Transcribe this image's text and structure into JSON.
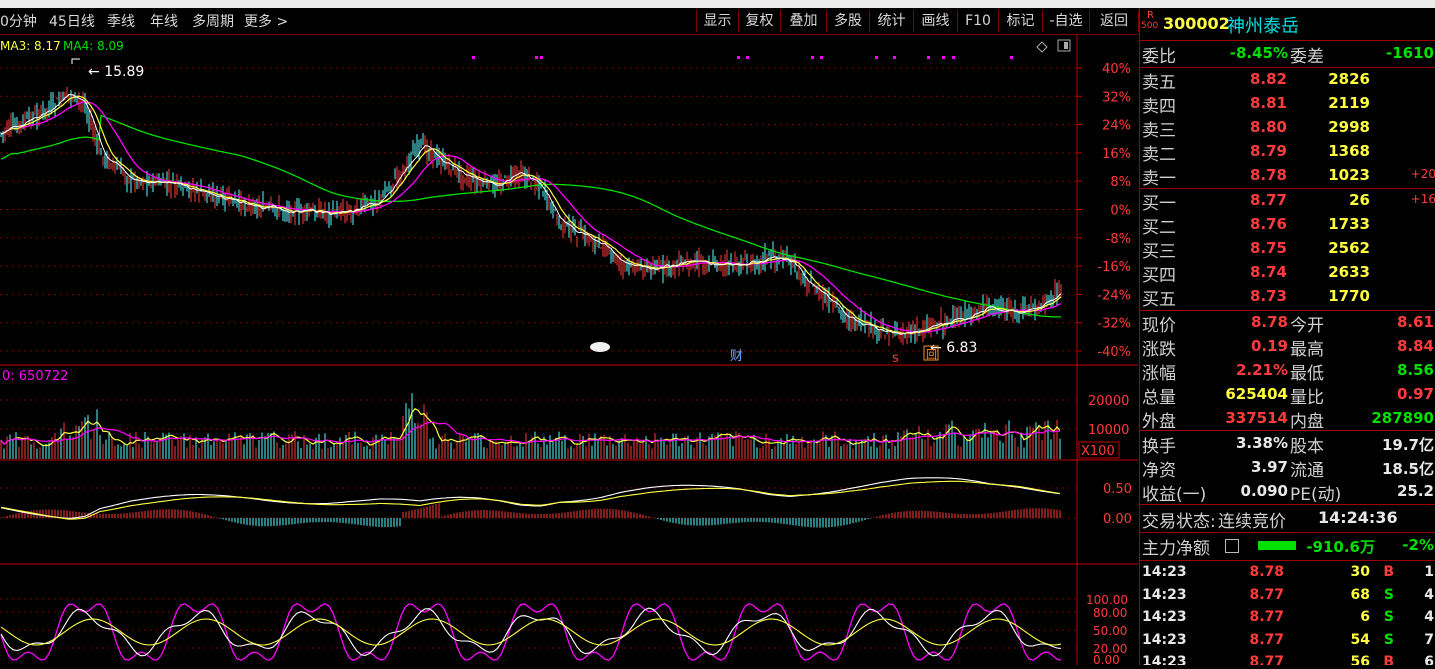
{
  "colors": {
    "up": "#ff3b3b",
    "down": "#54ffff",
    "ma_yellow": "#ffff40",
    "ma_magenta": "#ff00ff",
    "ma_green": "#00e000",
    "axis_red": "#c00000"
  },
  "period_buttons": [
    "0分钟",
    "45日线",
    "季线",
    "年线",
    "多周期",
    "更多 >"
  ],
  "tool_buttons": [
    "显示",
    "复权",
    "叠加",
    "多股",
    "统计",
    "画线",
    "F10",
    "标记",
    "-自选",
    "返回"
  ],
  "main_chart": {
    "ma_labels": [
      {
        "text": "MA3: 8.17",
        "color": "#ffff40"
      },
      {
        "text": "MA4: 8.09",
        "color": "#00e000"
      }
    ],
    "high_label": "15.89",
    "low_label": "6.83",
    "y_ticks": [
      "40%",
      "32%",
      "24%",
      "16%",
      "8%",
      "0%",
      "-8%",
      "-16%",
      "-24%",
      "-32%",
      "-40%"
    ],
    "fin_marker": "财",
    "event_markers": [
      "s",
      "回"
    ]
  },
  "volume_chart": {
    "label": "0: 650722",
    "y_ticks": [
      "20000",
      "10000"
    ],
    "unit": "X100"
  },
  "macd_chart": {
    "y_ticks": [
      "0.50",
      "0.00"
    ]
  },
  "kdj_chart": {
    "y_ticks": [
      "100.00",
      "80.00",
      "50.00",
      "20.00",
      "0.00"
    ]
  },
  "quote": {
    "badge_top": "R",
    "badge_bottom": "500",
    "code": "300002",
    "name": "神州泰岳",
    "weibi_label": "委比",
    "weibi_value": "-8.45%",
    "weicha_label": "委差",
    "weicha_value": "-1610",
    "asks": [
      {
        "label": "卖五",
        "price": "8.82",
        "vol": "2826",
        "chg": ""
      },
      {
        "label": "卖四",
        "price": "8.81",
        "vol": "2119",
        "chg": ""
      },
      {
        "label": "卖三",
        "price": "8.80",
        "vol": "2998",
        "chg": ""
      },
      {
        "label": "卖二",
        "price": "8.79",
        "vol": "1368",
        "chg": ""
      },
      {
        "label": "卖一",
        "price": "8.78",
        "vol": "1023",
        "chg": "+20"
      }
    ],
    "bids": [
      {
        "label": "买一",
        "price": "8.77",
        "vol": "26",
        "chg": "+16"
      },
      {
        "label": "买二",
        "price": "8.76",
        "vol": "1733",
        "chg": ""
      },
      {
        "label": "买三",
        "price": "8.75",
        "vol": "2562",
        "chg": ""
      },
      {
        "label": "买四",
        "price": "8.74",
        "vol": "2633",
        "chg": ""
      },
      {
        "label": "买五",
        "price": "8.73",
        "vol": "1770",
        "chg": ""
      }
    ],
    "stats": [
      {
        "l1": "现价",
        "v1": "8.78",
        "c1": "red",
        "l2": "今开",
        "v2": "8.61",
        "c2": "red"
      },
      {
        "l1": "涨跌",
        "v1": "0.19",
        "c1": "red",
        "l2": "最高",
        "v2": "8.84",
        "c2": "red"
      },
      {
        "l1": "涨幅",
        "v1": "2.21%",
        "c1": "red",
        "l2": "最低",
        "v2": "8.56",
        "c2": "grn"
      },
      {
        "l1": "总量",
        "v1": "625404",
        "c1": "yel",
        "l2": "量比",
        "v2": "0.97",
        "c2": "red"
      },
      {
        "l1": "外盘",
        "v1": "337514",
        "c1": "red",
        "l2": "内盘",
        "v2": "287890",
        "c2": "grn"
      }
    ],
    "stats2": [
      {
        "l1": "换手",
        "v1": "3.38%",
        "l2": "股本",
        "v2": "19.7亿"
      },
      {
        "l1": "净资",
        "v1": "3.97",
        "l2": "流通",
        "v2": "18.5亿"
      },
      {
        "l1": "收益(一)",
        "v1": "0.090",
        "l2": "PE(动)",
        "v2": "25.2"
      }
    ],
    "trade_status_label": "交易状态:",
    "trade_status_value": "连续竞价",
    "trade_time": "14:24:36",
    "main_force_label": "主力净额",
    "main_force_value": "-910.6万",
    "main_force_pct": "-2%",
    "ticks": [
      {
        "time": "14:23",
        "price": "8.78",
        "vol": "30",
        "bs": "B",
        "n": "1"
      },
      {
        "time": "14:23",
        "price": "8.77",
        "vol": "68",
        "bs": "S",
        "n": "4"
      },
      {
        "time": "14:23",
        "price": "8.77",
        "vol": "6",
        "bs": "S",
        "n": "4"
      },
      {
        "time": "14:23",
        "price": "8.77",
        "vol": "54",
        "bs": "S",
        "n": "7"
      },
      {
        "time": "14:23",
        "price": "8.77",
        "vol": "56",
        "bs": "B",
        "n": "6"
      }
    ]
  }
}
